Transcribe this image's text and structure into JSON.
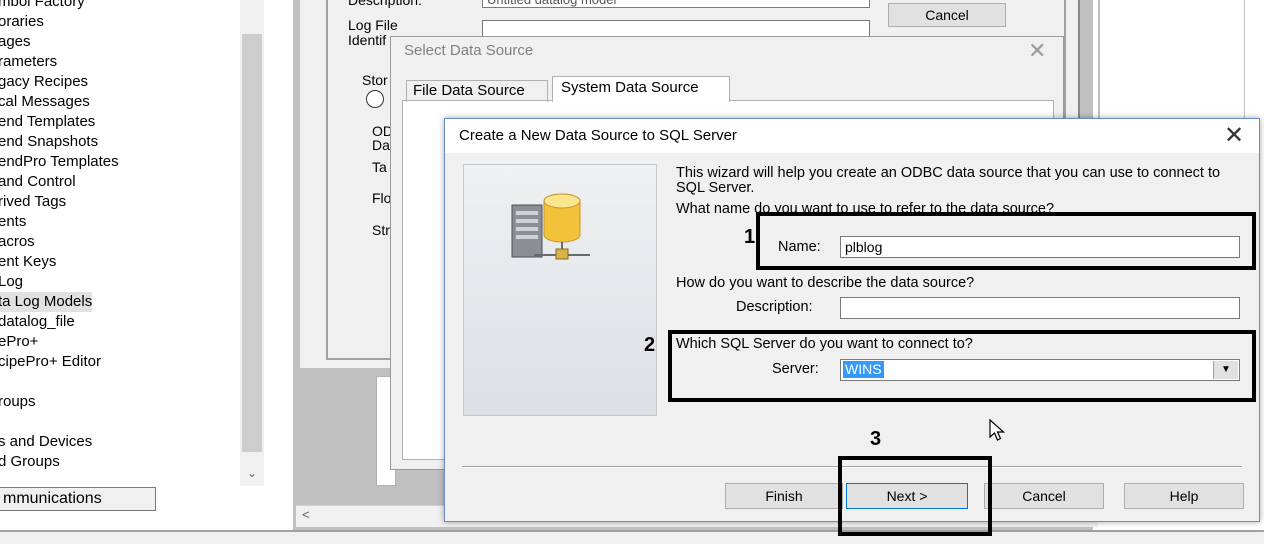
{
  "tree": {
    "items": [
      {
        "label": "mbol Factory",
        "selected": false
      },
      {
        "label": "oraries",
        "selected": false
      },
      {
        "label": "ages",
        "selected": false
      },
      {
        "label": "rameters",
        "selected": false
      },
      {
        "label": "gacy Recipes",
        "selected": false
      },
      {
        "label": "cal Messages",
        "selected": false
      },
      {
        "label": "end Templates",
        "selected": false
      },
      {
        "label": "end Snapshots",
        "selected": false
      },
      {
        "label": "endPro Templates",
        "selected": false
      },
      {
        "label": " and Control",
        "selected": false
      },
      {
        "label": "rived Tags",
        "selected": false
      },
      {
        "label": "ents",
        "selected": false
      },
      {
        "label": "acros",
        "selected": false
      },
      {
        "label": "ent Keys",
        "selected": false
      },
      {
        "label": "Log",
        "selected": false
      },
      {
        "label": "ta Log Models",
        "selected": true
      },
      {
        "label": "datalog_file",
        "selected": false
      },
      {
        "label": "ePro+",
        "selected": false
      },
      {
        "label": "cipePro+ Editor",
        "selected": false
      },
      {
        "label": "",
        "selected": false
      },
      {
        "label": "roups",
        "selected": false
      },
      {
        "label": "",
        "selected": false
      },
      {
        "label": "s and Devices",
        "selected": false
      },
      {
        "label": "d Groups",
        "selected": false
      }
    ],
    "bottom_tab": "mmunications"
  },
  "props_dialog": {
    "description_label": "Description:",
    "description_value": "Untitled datalog model",
    "log_file_label": "Log File\nIdentif",
    "cancel_label": "Cancel",
    "side_labels": [
      "Stor",
      "OD",
      "Da",
      "Ta",
      "Flo",
      "Str"
    ]
  },
  "select_dialog": {
    "title": "Select Data Source",
    "tabs": [
      "File Data Source",
      "System Data Source"
    ],
    "active_tab": "System Data Source"
  },
  "create_dialog": {
    "title": "Create a New Data Source to SQL Server",
    "intro": "This wizard will help you create an ODBC data source that you can use to connect to SQL Server.",
    "name_question": "What name do you want to use to refer to the data source?",
    "name_label": "Name:",
    "name_value": "plblog",
    "desc_question": "How do you want to describe the data source?",
    "desc_label": "Description:",
    "desc_value": "",
    "server_question": "Which SQL Server do you want to connect to?",
    "server_label": "Server:",
    "server_value": "WINS",
    "buttons": {
      "finish": "Finish",
      "next": "Next >",
      "cancel": "Cancel",
      "help": "Help"
    }
  },
  "annotations": [
    "1",
    "2",
    "3"
  ],
  "colors": {
    "selection": "#3399ff",
    "focus_border": "#0078d7",
    "annotation": "#000000"
  }
}
